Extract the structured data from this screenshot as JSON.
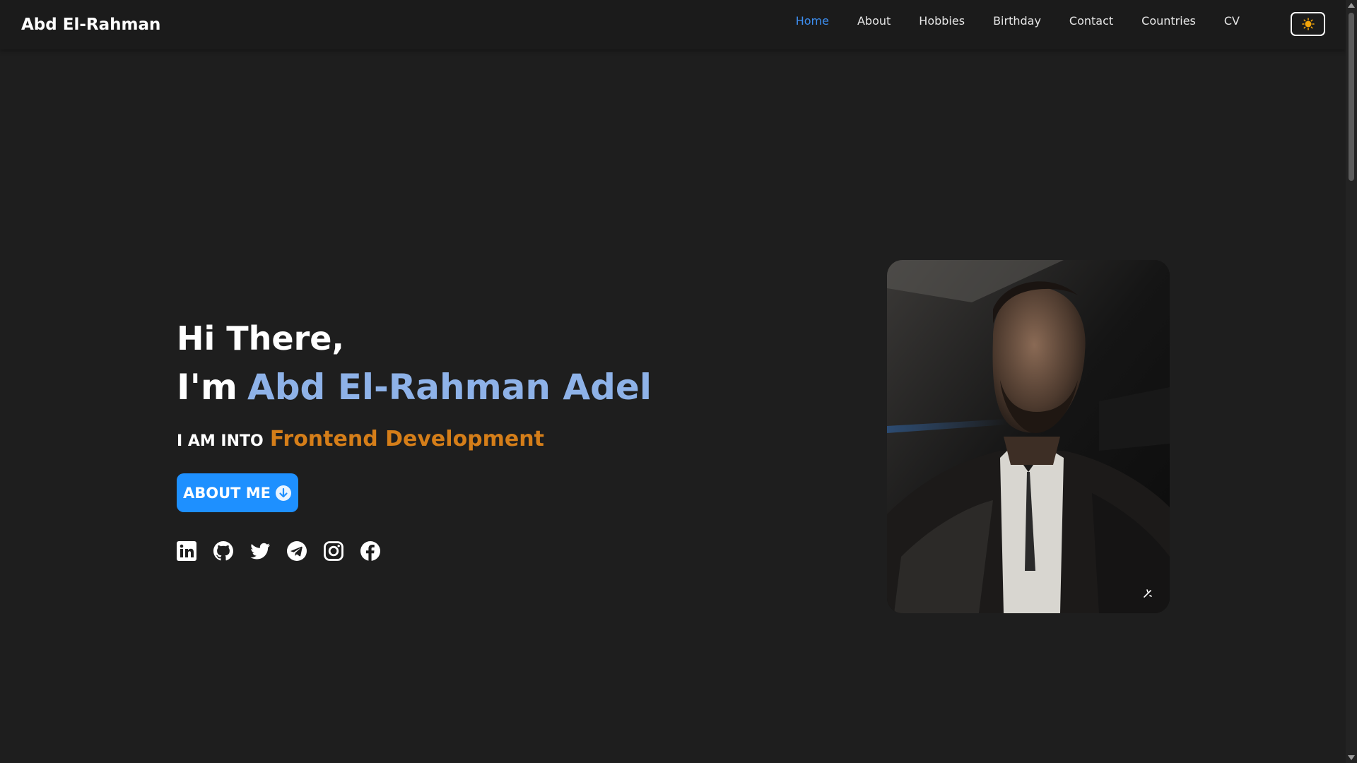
{
  "header": {
    "brand": "Abd El-Rahman",
    "nav": [
      {
        "label": "Home",
        "active": true
      },
      {
        "label": "About",
        "active": false
      },
      {
        "label": "Hobbies",
        "active": false
      },
      {
        "label": "Birthday",
        "active": false
      },
      {
        "label": "Contact",
        "active": false
      },
      {
        "label": "Countries",
        "active": false
      },
      {
        "label": "CV",
        "active": false
      }
    ],
    "theme_toggle_icon": "sun-icon"
  },
  "hero": {
    "greeting": "Hi There,",
    "im_prefix": "I'm",
    "name": "Abd El-Rahman Adel",
    "into_prefix": "I AM INTO",
    "role": "Frontend Development",
    "about_button_label": "ABOUT ME",
    "about_button_icon": "arrow-down-circle-icon",
    "socials": [
      "linkedin-icon",
      "github-icon",
      "twitter-icon",
      "telegram-icon",
      "instagram-icon",
      "facebook-icon"
    ]
  },
  "colors": {
    "background": "#1e1e1e",
    "nav_active": "#3d8ef0",
    "name_accent": "#8eb2e8",
    "role_accent": "#d57e19",
    "button": "#1e90ff",
    "sun": "#f2a40a"
  }
}
